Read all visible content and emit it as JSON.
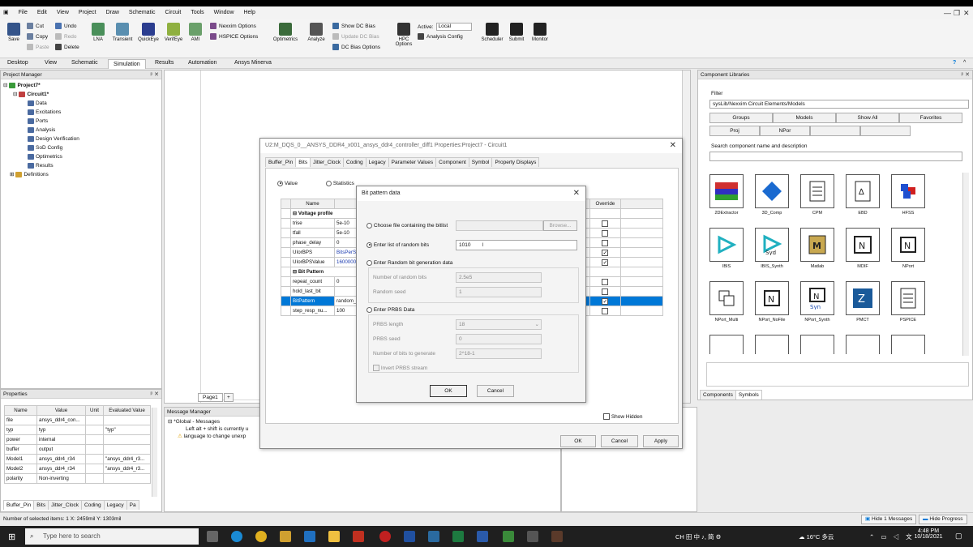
{
  "window": {
    "title": "Ansys Electronics Desktop 2021 R2 - Project7 - Circuit1 - Schematic - ansys_ddr4_controller_diff1"
  },
  "menu": [
    "File",
    "Edit",
    "View",
    "Project",
    "Draw",
    "Schematic",
    "Circuit",
    "Tools",
    "Window",
    "Help"
  ],
  "ribbon": {
    "save": "Save",
    "cut": "Cut",
    "copy": "Copy",
    "paste": "Paste",
    "undo": "Undo",
    "redo": "Redo",
    "delete": "Delete",
    "analyses": [
      "LNA",
      "Transient",
      "QuickEye",
      "VerifEye",
      "AMI"
    ],
    "nexxim_options": "Nexxim Options",
    "hspice_options": "HSPICE Options",
    "optimetrics": "Optimetrics",
    "analyze": "Analyze",
    "show_dc_bias": "Show DC Bias",
    "update_dc_bias": "Update DC Bias",
    "dc_bias_options": "DC Bias Options",
    "hpc_options": "HPC Options",
    "active_label": "Active:",
    "active_value": "Local",
    "analysis_config": "Analysis Config",
    "scheduler": "Scheduler",
    "submit": "Submit",
    "monitor": "Monitor"
  },
  "tabs": [
    "Desktop",
    "View",
    "Schematic",
    "Simulation",
    "Results",
    "Automation",
    "Ansys Minerva"
  ],
  "project_manager": {
    "title": "Project Manager",
    "items": [
      {
        "label": "Project7*",
        "level": 0
      },
      {
        "label": "Circuit1*",
        "level": 1
      },
      {
        "label": "Data",
        "level": 2
      },
      {
        "label": "Excitations",
        "level": 2
      },
      {
        "label": "Ports",
        "level": 2
      },
      {
        "label": "Analysis",
        "level": 2
      },
      {
        "label": "Design Verification",
        "level": 2
      },
      {
        "label": "SoD Config",
        "level": 2
      },
      {
        "label": "Optimetrics",
        "level": 2
      },
      {
        "label": "Results",
        "level": 2
      },
      {
        "label": "Definitions",
        "level": 0
      }
    ]
  },
  "properties": {
    "title": "Properties",
    "headers": [
      "Name",
      "Value",
      "Unit",
      "Evaluated Value"
    ],
    "rows": [
      [
        "file",
        "ansys_ddr4_con...",
        "",
        ""
      ],
      [
        "typ",
        "typ",
        "",
        "\"typ\""
      ],
      [
        "power",
        "internal",
        "",
        ""
      ],
      [
        "buffer",
        "output",
        "",
        ""
      ],
      [
        "Model1",
        "ansys_ddr4_r34",
        "",
        "\"ansys_ddr4_r3..."
      ],
      [
        "Model2",
        "ansys_ddr4_r34",
        "",
        "\"ansys_ddr4_r3..."
      ],
      [
        "polarity",
        "Non-inverting",
        "",
        ""
      ]
    ],
    "tabs": [
      "Buffer_Pin",
      "Bits",
      "Jitter_Clock",
      "Coding",
      "Legacy",
      "Pa"
    ]
  },
  "message_manager": {
    "title": "Message Manager",
    "group": "*Global - Messages",
    "line1": "Left alt + shift is currently u",
    "line2": "language to change unexp"
  },
  "schematic": {
    "page_tab": "Page1"
  },
  "component_libraries": {
    "title": "Component Libraries",
    "filter_label": "Filter",
    "filter_value": "sysLib/Nexxim Circuit Elements/Models",
    "buttons_row1": [
      "Groups",
      "Models",
      "Show All",
      "Favorites"
    ],
    "buttons_row2": [
      "Proj",
      "NPor",
      "",
      ""
    ],
    "search_label": "Search component name and description",
    "components": [
      {
        "name": "2DExtractor",
        "icon": "extractor-icon"
      },
      {
        "name": "3D_Comp",
        "icon": "3d-comp-icon"
      },
      {
        "name": "CPM",
        "icon": "cpm-icon"
      },
      {
        "name": "EBD",
        "icon": "ebd-icon"
      },
      {
        "name": "HFSS",
        "icon": "hfss-icon"
      },
      {
        "name": "IBIS",
        "icon": "ibis-icon"
      },
      {
        "name": "IBIS_Synth",
        "icon": "ibis-synth-icon"
      },
      {
        "name": "Matlab",
        "icon": "matlab-icon"
      },
      {
        "name": "MDIF",
        "icon": "mdif-icon"
      },
      {
        "name": "NPort",
        "icon": "nport-icon"
      },
      {
        "name": "NPort_Multi",
        "icon": "nport-multi-icon"
      },
      {
        "name": "NPort_NoFile",
        "icon": "nport-nofile-icon"
      },
      {
        "name": "NPort_Synth",
        "icon": "nport-synth-icon"
      },
      {
        "name": "PMCT",
        "icon": "pmct-icon"
      },
      {
        "name": "PSPICE",
        "icon": "pspice-icon"
      }
    ],
    "bottom_tabs": [
      "Components",
      "Symbols"
    ]
  },
  "properties_dialog": {
    "title": "U2:M_DQS_0__ANSYS_DDR4_x001_ansys_ddr4_controller_diff1 Properties:Project7 - Circuit1",
    "tabs": [
      "Buffer_Pin",
      "Bits",
      "Jitter_Clock",
      "Coding",
      "Legacy",
      "Parameter Values",
      "Component",
      "Symbol",
      "Property Displays"
    ],
    "radio_value": "Value",
    "radio_statistics": "Statistics",
    "col_name": "Name",
    "col_override": "Override",
    "rows": [
      {
        "name": "Voltage profile",
        "value": "",
        "group": true
      },
      {
        "name": "trise",
        "value": "5e-10"
      },
      {
        "name": "tfall",
        "value": "5e-10"
      },
      {
        "name": "phase_delay",
        "value": "0"
      },
      {
        "name": "UIorBPS",
        "value": "BitsPerSe"
      },
      {
        "name": "UIorBPSValue",
        "value": "1600000"
      },
      {
        "name": "Bit Pattern",
        "value": "",
        "group": true
      },
      {
        "name": "repeat_count",
        "value": "0"
      },
      {
        "name": "hold_last_bit",
        "value": ""
      },
      {
        "name": "BitPattern",
        "value": "random_b"
      },
      {
        "name": "step_resp_nu...",
        "value": "100"
      }
    ],
    "show_hidden": "Show Hidden",
    "ok": "OK",
    "cancel": "Cancel",
    "apply": "Apply"
  },
  "bit_pattern_dialog": {
    "title": "Bit pattern data",
    "opt_file": "Choose file containing the bitlist",
    "browse": "Browse...",
    "opt_list": "Enter list of random bits",
    "list_value": "1010",
    "opt_random": "Enter Random bit generation data",
    "num_random_bits_label": "Number of random bits",
    "num_random_bits": "2.5e5",
    "random_seed_label": "Random seed",
    "random_seed": "1",
    "opt_prbs": "Enter PRBS Data",
    "prbs_length_label": "PRBS length",
    "prbs_length": "18",
    "prbs_seed_label": "PRBS seed",
    "prbs_seed": "0",
    "num_bits_label": "Number of bits to generate",
    "num_bits": "2^18-1",
    "invert_label": "Invert PRBS stream",
    "ok": "OK",
    "cancel": "Cancel"
  },
  "statusbar": {
    "text": "Number of selected items: 1   X: 2459mil  Y: 1303mil",
    "hide_messages": "Hide 1 Messages",
    "hide_progress": "Hide Progress"
  },
  "taskbar": {
    "search": "Type here to search",
    "weather": "16°C 多云",
    "ime": "CH 田 中 ♪, 简 ⚙",
    "time": "4:48 PM",
    "date": "10/18/2021"
  },
  "colors": {
    "accent": "#0078d7",
    "selection": "#0078d7",
    "taskbar": "#1f1f1f"
  }
}
